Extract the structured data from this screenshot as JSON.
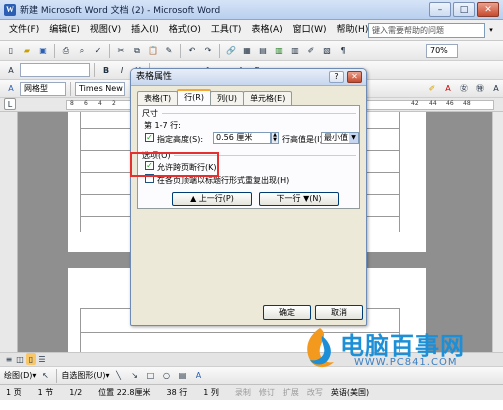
{
  "window": {
    "title": "新建 Microsoft Word 文档 (2) - Microsoft Word"
  },
  "menu": {
    "items": [
      "文件(F)",
      "编辑(E)",
      "视图(V)",
      "插入(I)",
      "格式(O)",
      "工具(T)",
      "表格(A)",
      "窗口(W)",
      "帮助(H)"
    ],
    "help_placeholder": "键入需要帮助的问题"
  },
  "toolbar": {
    "zoom": "70%",
    "style": "网格型",
    "font": "Times New"
  },
  "dialog": {
    "title": "表格属性",
    "help_glyph": "?",
    "close_glyph": "✕",
    "tabs": [
      "表格(T)",
      "行(R)",
      "列(U)",
      "单元格(E)"
    ],
    "active_tab": 1,
    "size_group": "尺寸",
    "row_range": "第 1-7 行:",
    "specify_height_label": "指定高度(S):",
    "specify_height_checked": true,
    "height_value": "0.56 厘米",
    "row_height_is_label": "行高值是(I):",
    "row_height_mode": "最小值",
    "options_group": "选项(O)",
    "allow_break_label": "允许跨页断行(K)",
    "allow_break_checked": true,
    "repeat_header_label": "在各页顶端以标题行形式重复出现(H)",
    "repeat_header_checked": false,
    "prev_row_button": "▲ 上一行(P)",
    "next_row_button": "下一行 ▼(N)",
    "ok_button": "确定",
    "cancel_button": "取消"
  },
  "ruler": {
    "labels": [
      "8",
      "6",
      "4",
      "2",
      "42",
      "44",
      "46",
      "48"
    ]
  },
  "status": {
    "page": "1 页",
    "section": "1 节",
    "page_of": "1/2",
    "position": "位置 22.8厘米",
    "line": "38 行",
    "column": "1 列",
    "rec": "录制",
    "trk": "修订",
    "ext": "扩展",
    "ovr": "改写",
    "language": "英语(美国)"
  },
  "drawing": {
    "draw_label": "绘图(D)▾",
    "autoshapes_label": "自选图形(U)▾"
  },
  "watermark": {
    "name": "电脑百事网",
    "url": "WWW.PC841.COM"
  },
  "colors": {
    "accent": "#316ac5",
    "highlight": "#e53030",
    "watermark": "#1d8fd6"
  }
}
